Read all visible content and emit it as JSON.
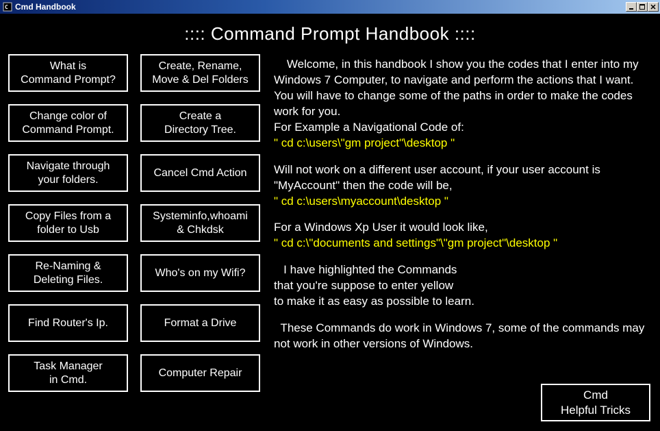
{
  "window": {
    "title": "Cmd Handbook"
  },
  "header": {
    "title": "::::   Command Prompt Handbook   ::::"
  },
  "menu": [
    {
      "id": "what-is-cmd",
      "label": "What is\nCommand Prompt?"
    },
    {
      "id": "create-rename",
      "label": "Create, Rename,\nMove & Del Folders"
    },
    {
      "id": "change-color",
      "label": "Change color of\nCommand Prompt."
    },
    {
      "id": "create-dir-tree",
      "label": "Create a\nDirectory Tree."
    },
    {
      "id": "navigate-folders",
      "label": "Navigate through\nyour folders."
    },
    {
      "id": "cancel-cmd",
      "label": "Cancel Cmd Action"
    },
    {
      "id": "copy-to-usb",
      "label": "Copy Files from a\nfolder to Usb"
    },
    {
      "id": "systeminfo",
      "label": "Systeminfo,whoami\n& Chkdsk"
    },
    {
      "id": "rename-delete",
      "label": "Re-Naming &\nDeleting Files."
    },
    {
      "id": "whos-on-wifi",
      "label": "Who's on my Wifi?"
    },
    {
      "id": "find-router-ip",
      "label": "Find Router's Ip."
    },
    {
      "id": "format-drive",
      "label": "Format a Drive"
    },
    {
      "id": "task-manager",
      "label": "Task Manager\nin Cmd."
    },
    {
      "id": "computer-repair",
      "label": "Computer Repair"
    }
  ],
  "content": {
    "p1a": "    Welcome, in this handbook I show you the codes that I enter into my Windows 7 Computer, to navigate and perform the actions that I want.",
    "p1b": "You will have to change some of the paths in order to make the codes work for you.",
    "p1c": "For Example a Navigational Code of:",
    "code1": "\" cd c:\\users\\\"gm project\"\\desktop \"",
    "p2a": "Will not work on a different user account, if your user account is \"MyAccount\" then the code will be,",
    "code2": "\" cd c:\\users\\myaccount\\desktop \"",
    "p3a": "For a Windows Xp User it would look like,",
    "code3": "\" cd c:\\\"documents and settings\"\\\"gm project\"\\desktop \"",
    "p4a": "   I have highlighted the Commands",
    "p4b": "that you're suppose to enter yellow",
    "p4c": "to make it as easy as possible to learn.",
    "p5": "  These Commands do work in Windows 7, some of the commands may not work in other versions of Windows."
  },
  "tricks": {
    "label": "Cmd\nHelpful Tricks"
  }
}
